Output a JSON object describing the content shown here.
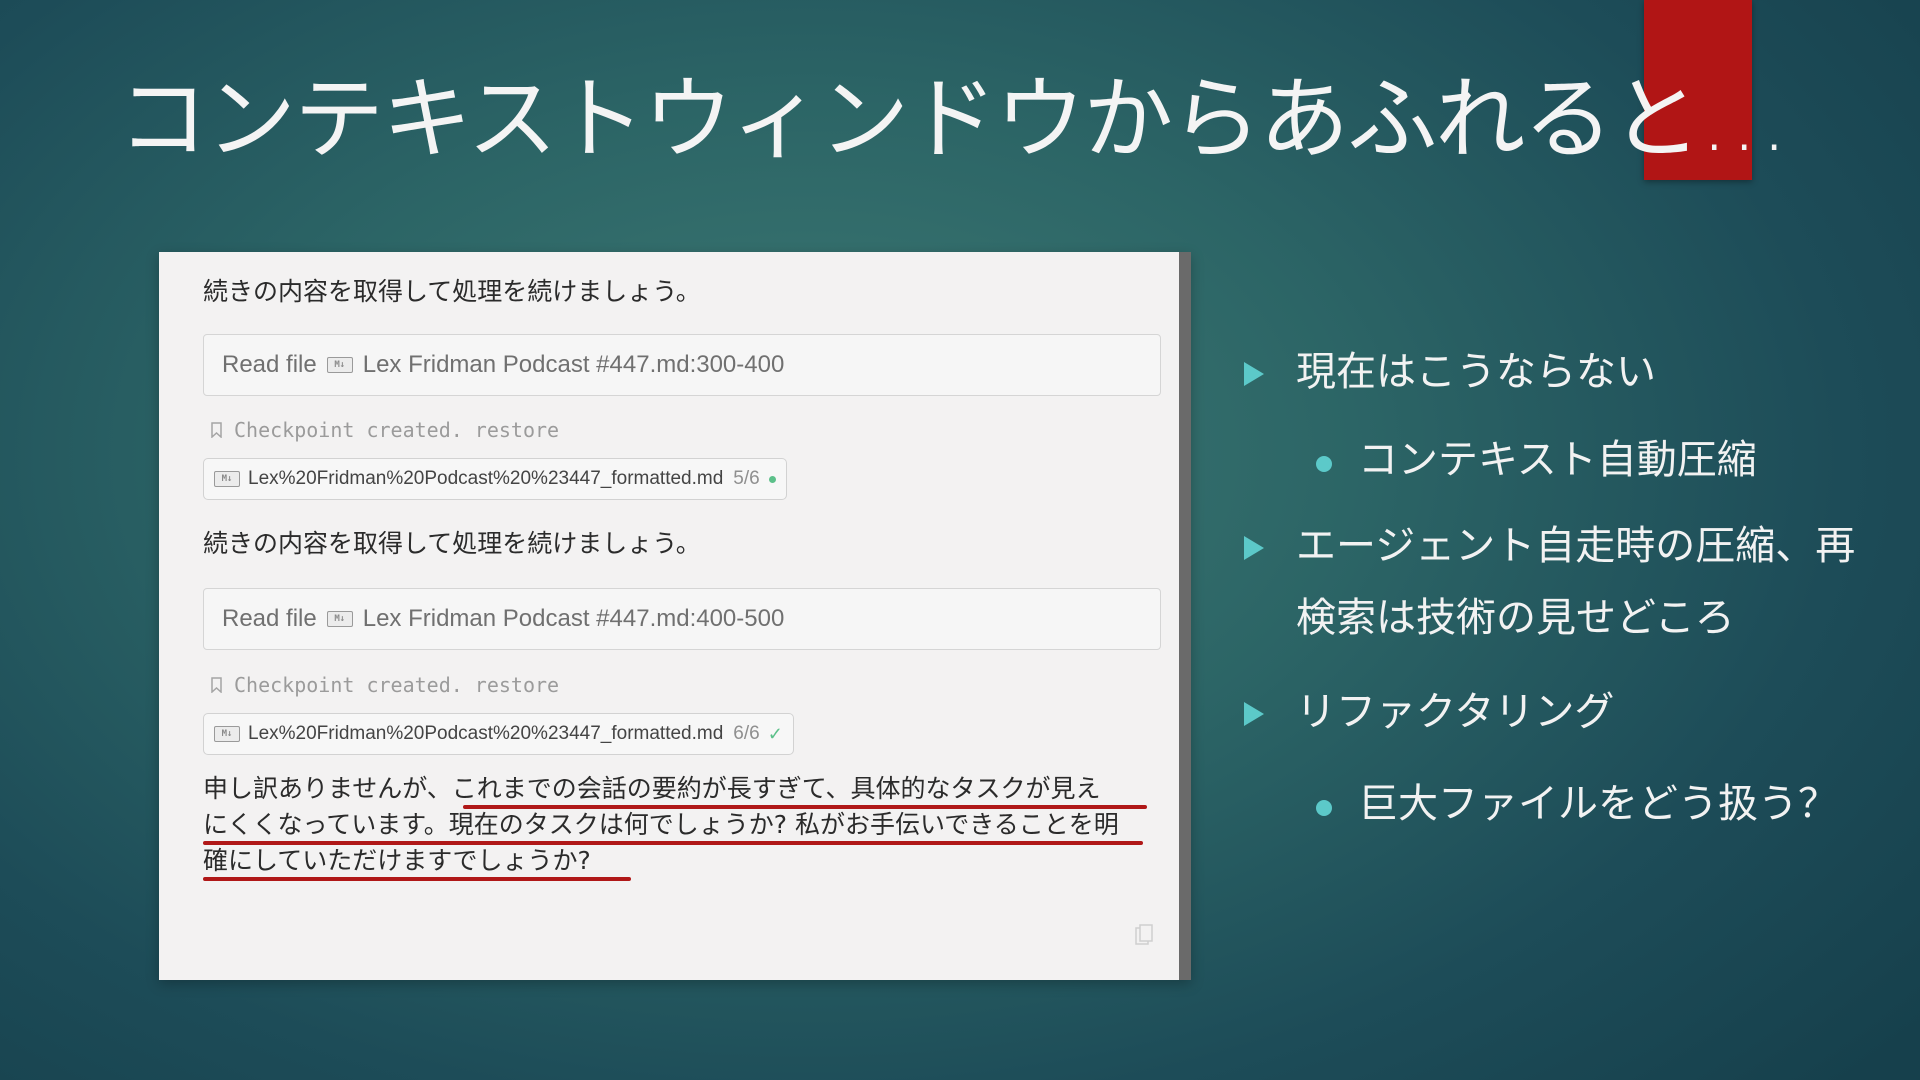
{
  "slide": {
    "title": "コンテキストウィンドウからあふれると…"
  },
  "screenshot": {
    "messages": {
      "continue_1": "続きの内容を取得して処理を続けましょう。",
      "continue_2": "続きの内容を取得して処理を続けましょう。"
    },
    "tool_calls": [
      {
        "action": "Read file",
        "file": "Lex Fridman Podcast #447.md:300-400"
      },
      {
        "action": "Read file",
        "file": "Lex Fridman Podcast #447.md:400-500"
      }
    ],
    "checkpoints": [
      {
        "label": "Checkpoint created.",
        "link": "restore"
      },
      {
        "label": "Checkpoint created.",
        "link": "restore"
      }
    ],
    "file_chips": [
      {
        "name": "Lex%20Fridman%20Podcast%20%23447_formatted.md",
        "count": "5/6"
      },
      {
        "name": "Lex%20Fridman%20Podcast%20%23447_formatted.md",
        "count": "6/6"
      }
    ],
    "icon_label": "M↓",
    "reply": {
      "line1_pre": "申し訳ありませんが、",
      "line1_emph": "これまでの会話の要約が長すぎて、具体的なタスクが見え",
      "line2": "にくくなっています。現在のタスクは何でしょうか? 私がお手伝いできることを明",
      "line3": "確にしていただけますでしょうか?"
    },
    "icons": [
      "bookmark-icon",
      "markdown-file-icon",
      "status-dot-icon",
      "check-icon",
      "copy-icon"
    ]
  },
  "bullets": [
    {
      "level": 1,
      "text": "現在はこうならない"
    },
    {
      "level": 2,
      "text": "コンテキスト自動圧縮"
    },
    {
      "level": 1,
      "text": "エージェント自走時の圧縮、再"
    },
    {
      "level": 1,
      "text": "検索は技術の見せどころ",
      "continuation": true
    },
    {
      "level": 1,
      "text": "リファクタリング"
    },
    {
      "level": 2,
      "text": "巨大ファイルをどう扱う？"
    }
  ],
  "colors": {
    "background": "#2c6566",
    "accent_red": "#b11515",
    "bullet_accent": "#5cc9c9",
    "underline_red": "#b01818",
    "status_green": "#5cc08a"
  }
}
